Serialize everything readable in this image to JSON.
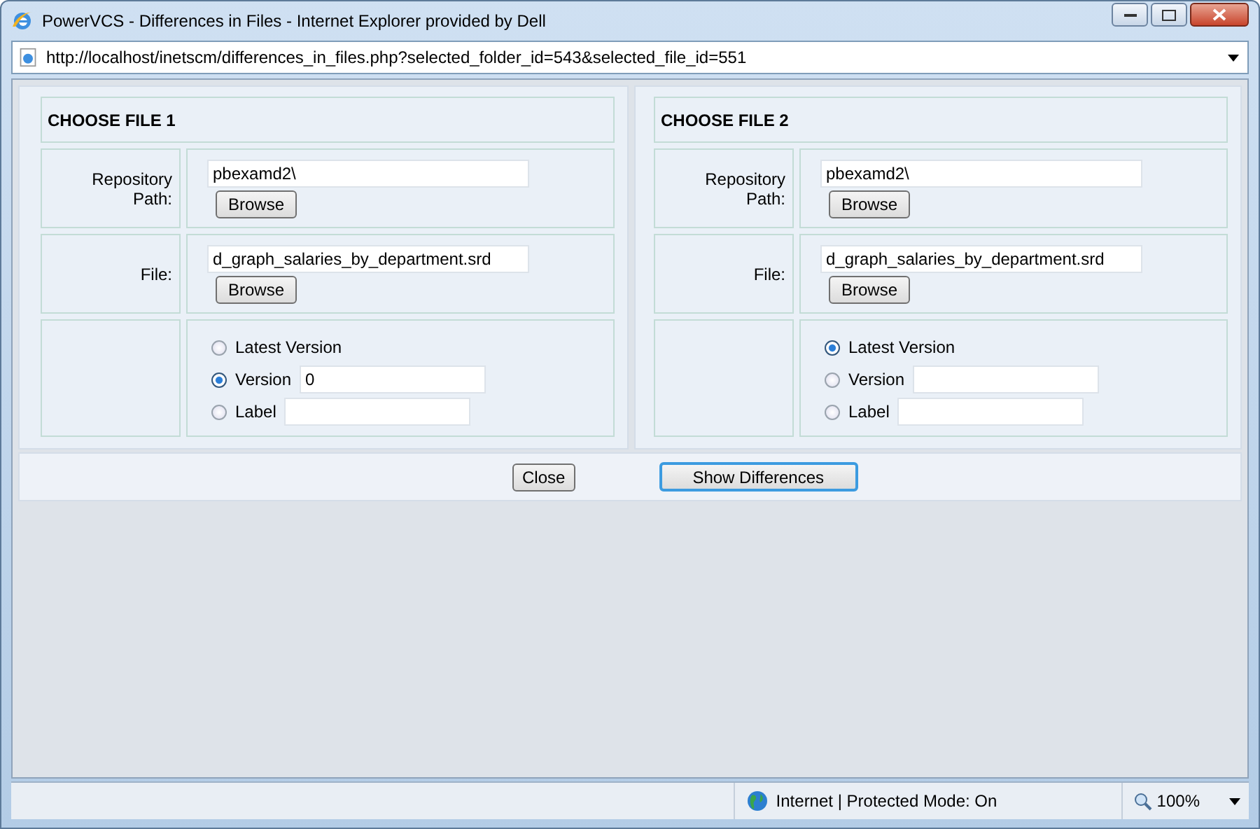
{
  "window": {
    "title": "PowerVCS - Differences in Files - Internet Explorer provided by Dell",
    "url": "http://localhost/inetscm/differences_in_files.php?selected_folder_id=543&selected_file_id=551"
  },
  "panels": [
    {
      "title": "CHOOSE FILE 1",
      "repository_label": "Repository Path:",
      "repository_path": "pbexamd2\\",
      "repository_button": "Browse",
      "file_label": "File:",
      "file": "d_graph_salaries_by_department.srd",
      "file_button": "Browse",
      "options": [
        {
          "label": "Latest Version",
          "selected": false
        },
        {
          "label": "Version",
          "selected": true,
          "value": "0"
        },
        {
          "label": "Label",
          "selected": false
        }
      ]
    },
    {
      "title": "CHOOSE FILE 2",
      "repository_label": "Repository Path:",
      "repository_path": "pbexamd2\\",
      "repository_button": "Browse",
      "file_label": "File:",
      "file": "d_graph_salaries_by_department.srd",
      "file_button": "Browse",
      "options": [
        {
          "label": "Latest Version",
          "selected": true
        },
        {
          "label": "Version",
          "selected": false
        },
        {
          "label": "Label",
          "selected": false
        }
      ]
    }
  ],
  "buttons": [
    {
      "label": "Close",
      "focused": false
    },
    {
      "label": "Show Differences",
      "focused": true
    }
  ],
  "status_bar": {
    "zone": "Internet | Protected Mode: On",
    "zoom": "100%"
  }
}
